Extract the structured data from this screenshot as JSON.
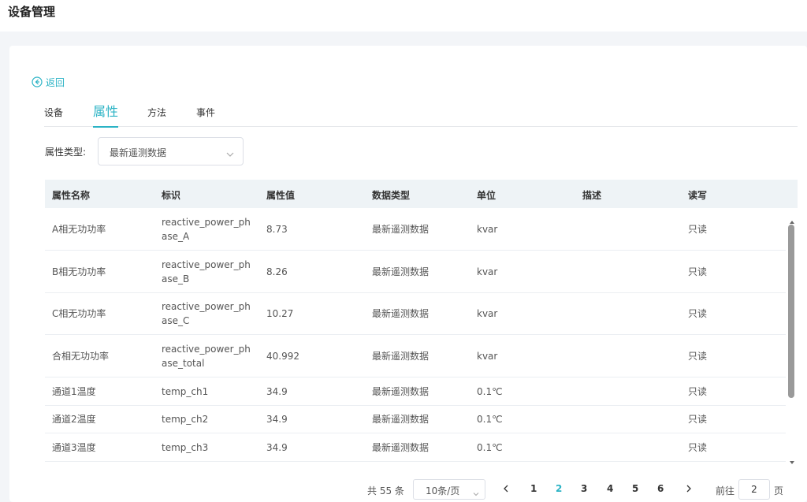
{
  "header": {
    "title": "设备管理"
  },
  "back": {
    "label": "返回"
  },
  "tabs": [
    {
      "label": "设备"
    },
    {
      "label": "属性"
    },
    {
      "label": "方法"
    },
    {
      "label": "事件"
    }
  ],
  "active_tab": "属性",
  "filter": {
    "label": "属性类型:",
    "value": "最新遥测数据"
  },
  "table": {
    "headers": [
      "属性名称",
      "标识",
      "属性值",
      "数据类型",
      "单位",
      "描述",
      "读写"
    ],
    "rows": [
      {
        "name": "A相无功功率",
        "ident": "reactive_power_phase_A",
        "value": "8.73",
        "type": "最新遥测数据",
        "unit": "kvar",
        "desc": "",
        "rw": "只读"
      },
      {
        "name": "B相无功功率",
        "ident": "reactive_power_phase_B",
        "value": "8.26",
        "type": "最新遥测数据",
        "unit": "kvar",
        "desc": "",
        "rw": "只读"
      },
      {
        "name": "C相无功功率",
        "ident": "reactive_power_phase_C",
        "value": "10.27",
        "type": "最新遥测数据",
        "unit": "kvar",
        "desc": "",
        "rw": "只读"
      },
      {
        "name": "合相无功功率",
        "ident": "reactive_power_phase_total",
        "value": "40.992",
        "type": "最新遥测数据",
        "unit": "kvar",
        "desc": "",
        "rw": "只读"
      },
      {
        "name": "通道1温度",
        "ident": "temp_ch1",
        "value": "34.9",
        "type": "最新遥测数据",
        "unit": "0.1℃",
        "desc": "",
        "rw": "只读"
      },
      {
        "name": "通道2温度",
        "ident": "temp_ch2",
        "value": "34.9",
        "type": "最新遥测数据",
        "unit": "0.1℃",
        "desc": "",
        "rw": "只读"
      },
      {
        "name": "通道3温度",
        "ident": "temp_ch3",
        "value": "34.9",
        "type": "最新遥测数据",
        "unit": "0.1℃",
        "desc": "",
        "rw": "只读"
      }
    ]
  },
  "pagination": {
    "total_text": "共 55 条",
    "page_size": "10条/页",
    "pages": [
      "1",
      "2",
      "3",
      "4",
      "5",
      "6"
    ],
    "current_page": "2",
    "goto_label": "前往",
    "goto_value": "2",
    "goto_suffix": "页"
  },
  "icons": {
    "back": "circle-arrow-left-icon",
    "dropdown": "chevron-down-icon",
    "prev": "chevron-left-icon",
    "next": "chevron-right-icon"
  },
  "colors": {
    "accent": "#2bb3c5",
    "header_bg": "#eef3f6"
  }
}
